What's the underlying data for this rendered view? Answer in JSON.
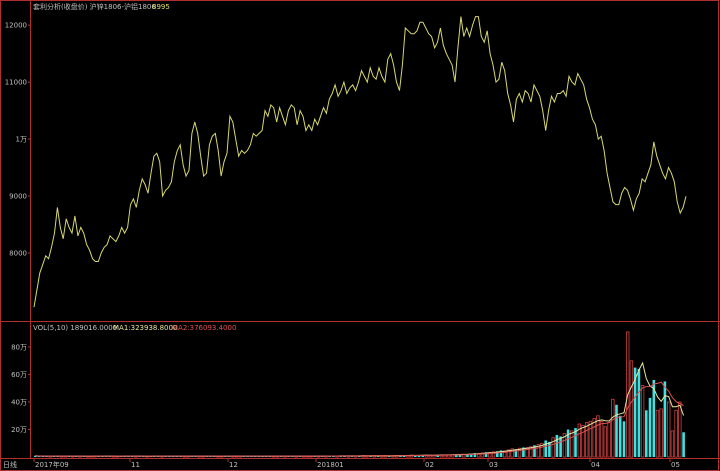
{
  "header": {
    "title": "套利分析(收盘价) 沪锌1806-沪铝1806",
    "last_value": "8995"
  },
  "colors": {
    "background": "#000000",
    "frame": "#b03030",
    "price_line": "#d8d870",
    "axis_text": "#c0c0c0",
    "vol_up": "#40e0e0",
    "vol_down": "#d04040",
    "ma1": "#e6e6a0",
    "ma2": "#e05050"
  },
  "price_panel": {
    "y_ticks": [
      {
        "label": "12000",
        "value": 12000
      },
      {
        "label": "11000",
        "value": 11000
      },
      {
        "label": "1万",
        "value": 10000
      },
      {
        "label": "9000",
        "value": 9000
      },
      {
        "label": "8000",
        "value": 8000
      }
    ]
  },
  "volume_panel": {
    "label": "VOL(5,10) 189016.0000",
    "ma1_label": "MA1:323938.8000",
    "ma2_label": "MA2:376093.4000",
    "y_ticks": [
      {
        "label": "80万",
        "value": 800000
      },
      {
        "label": "60万",
        "value": 600000
      },
      {
        "label": "40万",
        "value": 400000
      },
      {
        "label": "20万",
        "value": 200000
      }
    ]
  },
  "x_axis": {
    "unit_label": "日线",
    "ticks": [
      "2017年09",
      "11",
      "12",
      "201801",
      "02",
      "03",
      "04",
      "05"
    ]
  },
  "chart_data": [
    {
      "type": "line",
      "series": [
        {
          "values": [
            7050,
            7350,
            7650,
            7800,
            7950,
            7900,
            8100,
            8350,
            8800,
            8450,
            8250,
            8600,
            8450,
            8350,
            8650,
            8300,
            8450,
            8350,
            8150,
            8050,
            7900,
            7850,
            7850,
            8000,
            8100,
            8150,
            8300,
            8250,
            8200,
            8300,
            8450,
            8350,
            8450,
            8850,
            8950,
            8800,
            9100,
            9300,
            9200,
            9050,
            9400,
            9700,
            9750,
            9600,
            9000,
            9100,
            9150,
            9250,
            9600,
            9800,
            9900,
            9550,
            9350,
            9450,
            10100,
            10300,
            10100,
            9700,
            9350,
            9400,
            9900,
            10050,
            10100,
            9800,
            9350,
            9600,
            9750,
            10400,
            10300,
            10000,
            9700,
            9800,
            9750,
            9800,
            9900,
            10100,
            10050,
            10100,
            10150,
            10500,
            10400,
            10600,
            10550,
            10300,
            10550,
            10400,
            10250,
            10500,
            10600,
            10550,
            10250,
            10500,
            10400,
            10150,
            10250,
            10150,
            10350,
            10250,
            10400,
            10550,
            10450,
            10700,
            10800,
            10950,
            10750,
            10850,
            11000,
            10800,
            10900,
            10950,
            10850,
            11000,
            11200,
            11100,
            11000,
            11250,
            11100,
            11050,
            11250,
            11100,
            11000,
            11400,
            11500,
            11300,
            11000,
            10850,
            11300,
            11950,
            11900,
            11850,
            11850,
            11900,
            12050,
            12050,
            11950,
            11850,
            11800,
            11600,
            11700,
            11950,
            11650,
            11500,
            11400,
            11300,
            11000,
            11600,
            12150,
            11800,
            11950,
            11800,
            12000,
            12150,
            12150,
            11800,
            11700,
            11900,
            11500,
            11300,
            11000,
            11050,
            11350,
            11200,
            10800,
            10600,
            10300,
            10700,
            10800,
            10650,
            10850,
            10800,
            10650,
            10950,
            10850,
            10750,
            10500,
            10150,
            10500,
            10750,
            10650,
            10800,
            10800,
            10850,
            10750,
            11100,
            11000,
            10950,
            11150,
            11050,
            10950,
            10700,
            10550,
            10350,
            10250,
            10000,
            10050,
            9800,
            9400,
            9150,
            8900,
            8850,
            8850,
            9050,
            9150,
            9100,
            8950,
            8750,
            8950,
            9050,
            9300,
            9250,
            9400,
            9550,
            9950,
            9700,
            9550,
            9400,
            9300,
            9500,
            9400,
            9250,
            8900,
            8700,
            8800,
            8995
          ]
        }
      ]
    },
    {
      "type": "bar",
      "series": [
        {
          "values": [
            9000,
            6000,
            5000,
            7000,
            8000,
            6000,
            5000,
            6000,
            7000,
            8000,
            6000,
            5000,
            7000,
            6000,
            5000,
            6000,
            8000,
            7000,
            6000,
            5000,
            6000,
            7000,
            5000,
            6000,
            7000,
            8000,
            6000,
            5000,
            6000,
            7000,
            5000,
            6000,
            7000,
            8000,
            6000,
            7000,
            5000,
            6000,
            8000,
            7000,
            6000,
            5000,
            6000,
            7000,
            8000,
            6000,
            5000,
            6000,
            7000,
            5000,
            6000,
            8000,
            7000,
            6000,
            5000,
            7000,
            8000,
            6000,
            5000,
            6000,
            7000,
            6000,
            8000,
            7000,
            5000,
            6000,
            7000,
            8000,
            6000,
            5000,
            7000,
            6000,
            8000,
            7000,
            6000,
            7000,
            8000,
            6000,
            7000,
            8000,
            9000,
            7000,
            8000,
            7000,
            9000,
            8000,
            7000,
            9000,
            10000,
            8000,
            9000,
            10000,
            8000,
            9000,
            11000,
            10000,
            9000,
            12000,
            10000,
            11000,
            12000,
            13000,
            11000,
            12000,
            14000,
            15000,
            13000,
            12000,
            15000,
            16000,
            17000,
            15000,
            18000,
            20000,
            22000,
            19000,
            21000,
            24000,
            28000,
            26000,
            30000,
            35000,
            32000,
            38000,
            42000,
            48000,
            45000,
            52000,
            60000,
            56000,
            64000,
            70000,
            68000,
            75000,
            85000,
            90000,
            100000,
            120000,
            110000,
            140000,
            160000,
            150000,
            170000,
            200000,
            190000,
            210000,
            240000,
            230000,
            250000,
            260000,
            280000,
            300000,
            260000,
            220000,
            250000,
            420000,
            380000,
            300000,
            260000,
            910000,
            700000,
            650000,
            640000,
            520000,
            340000,
            430000,
            560000,
            340000,
            350000,
            550000,
            400000,
            190000,
            340000,
            400000,
            180000
          ]
        }
      ]
    }
  ]
}
